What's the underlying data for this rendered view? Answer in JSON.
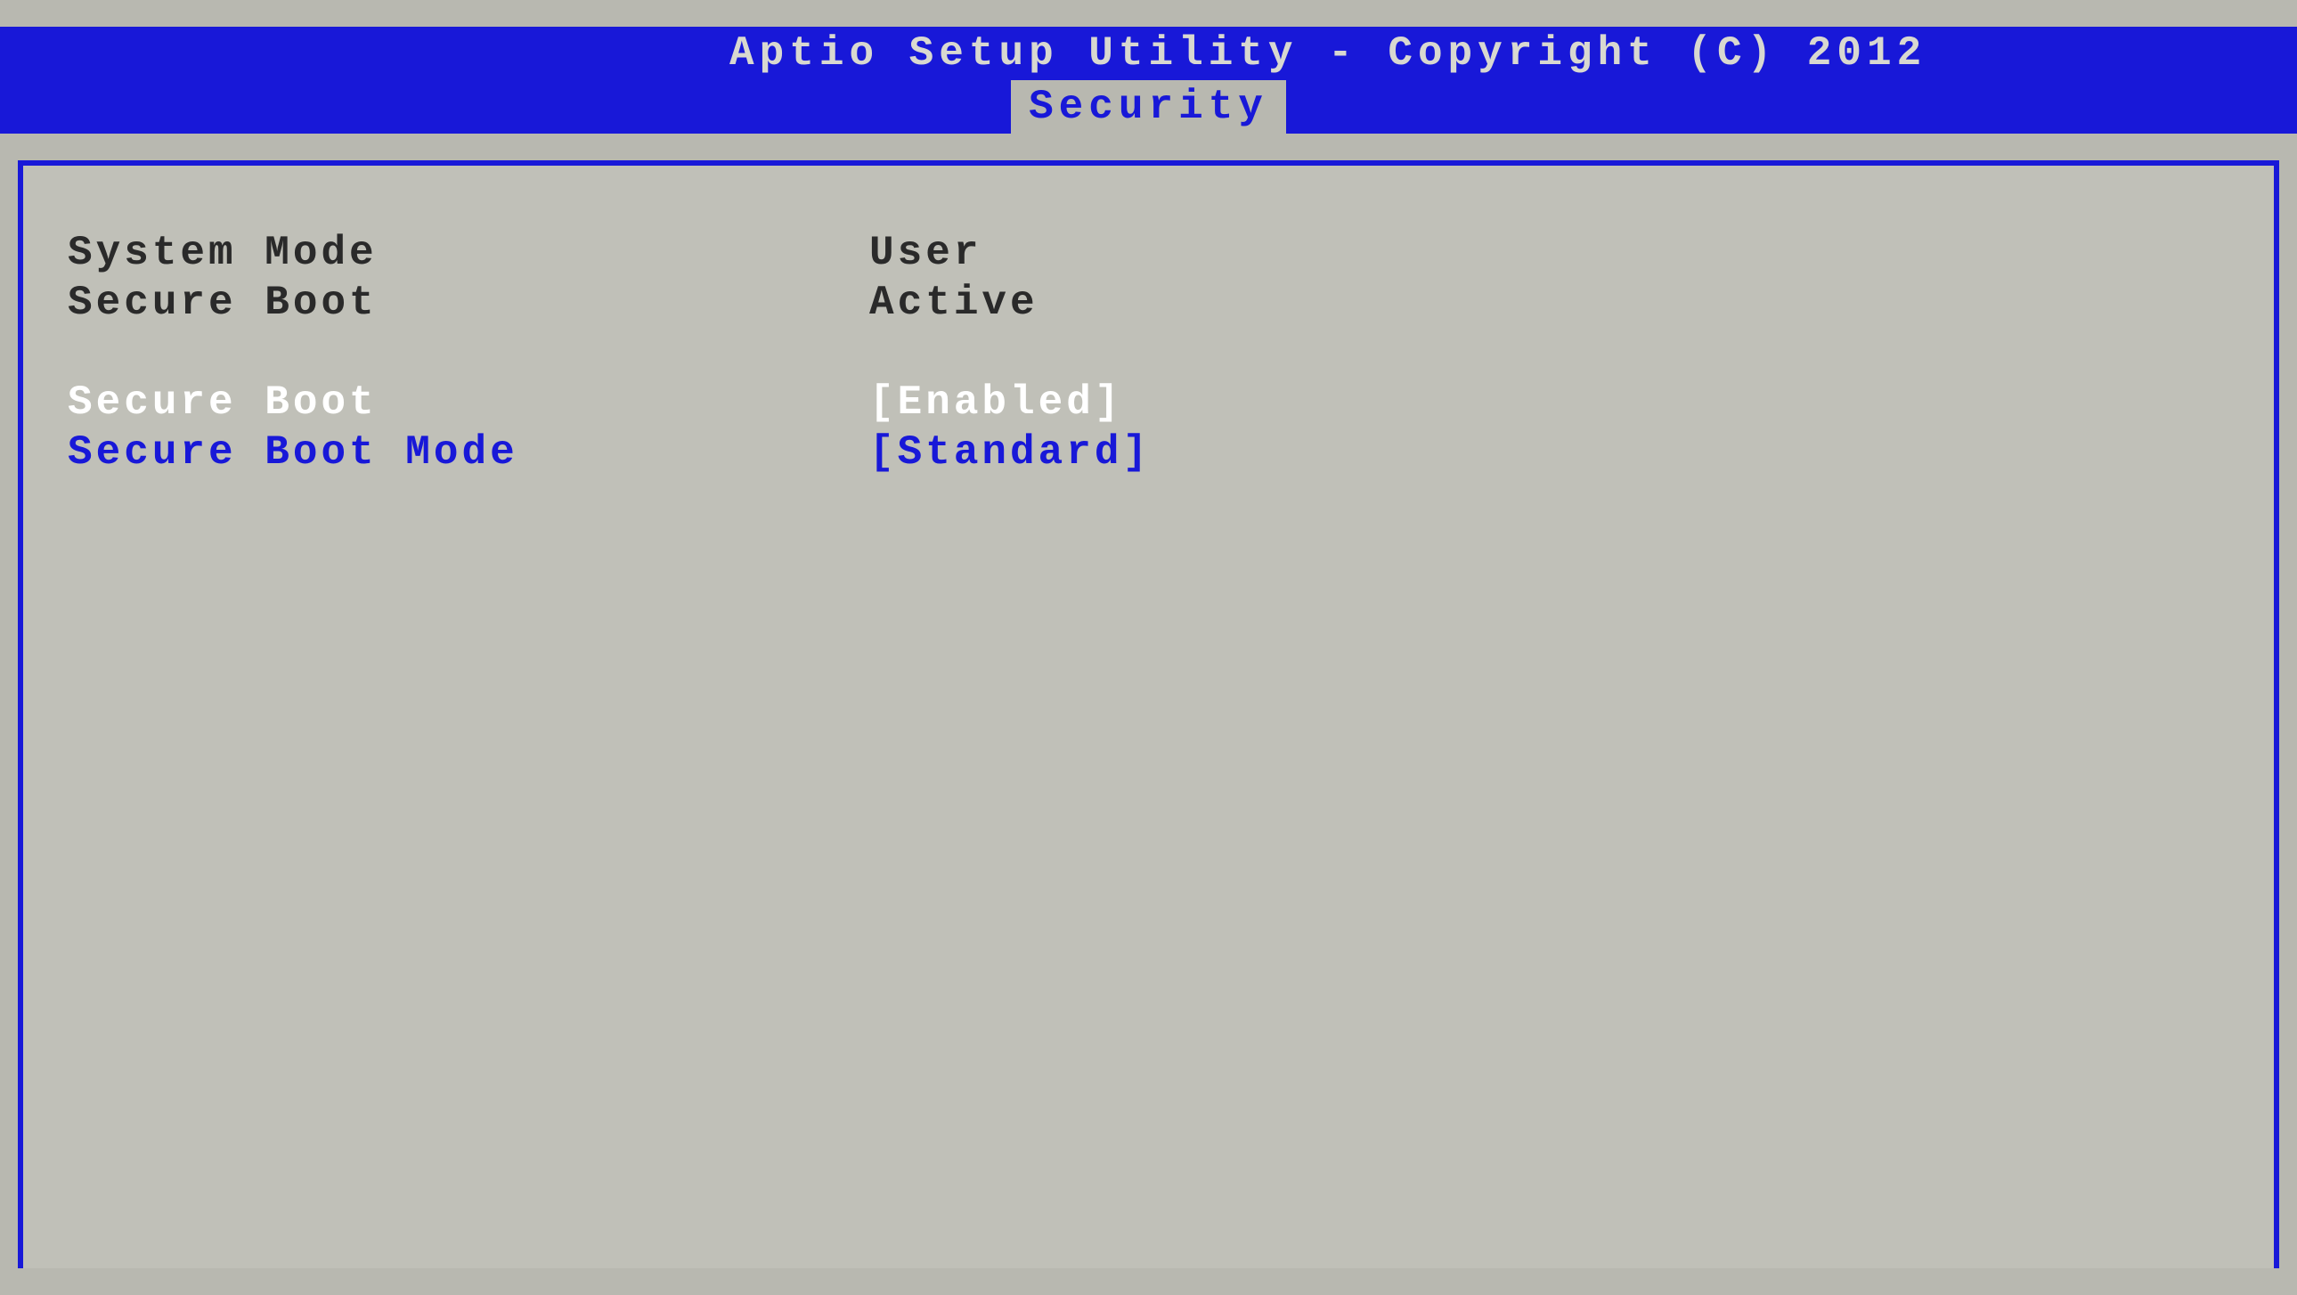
{
  "header": {
    "title": "Aptio Setup Utility - Copyright (C) 2012"
  },
  "tabs": {
    "active": "Security"
  },
  "info_rows": [
    {
      "label": "System Mode",
      "value": "User"
    },
    {
      "label": "Secure Boot",
      "value": "Active"
    }
  ],
  "settings": [
    {
      "label": "Secure Boot",
      "value": "[Enabled]",
      "selected": true
    },
    {
      "label": "Secure Boot Mode",
      "value": "[Standard]",
      "selected": false
    }
  ]
}
